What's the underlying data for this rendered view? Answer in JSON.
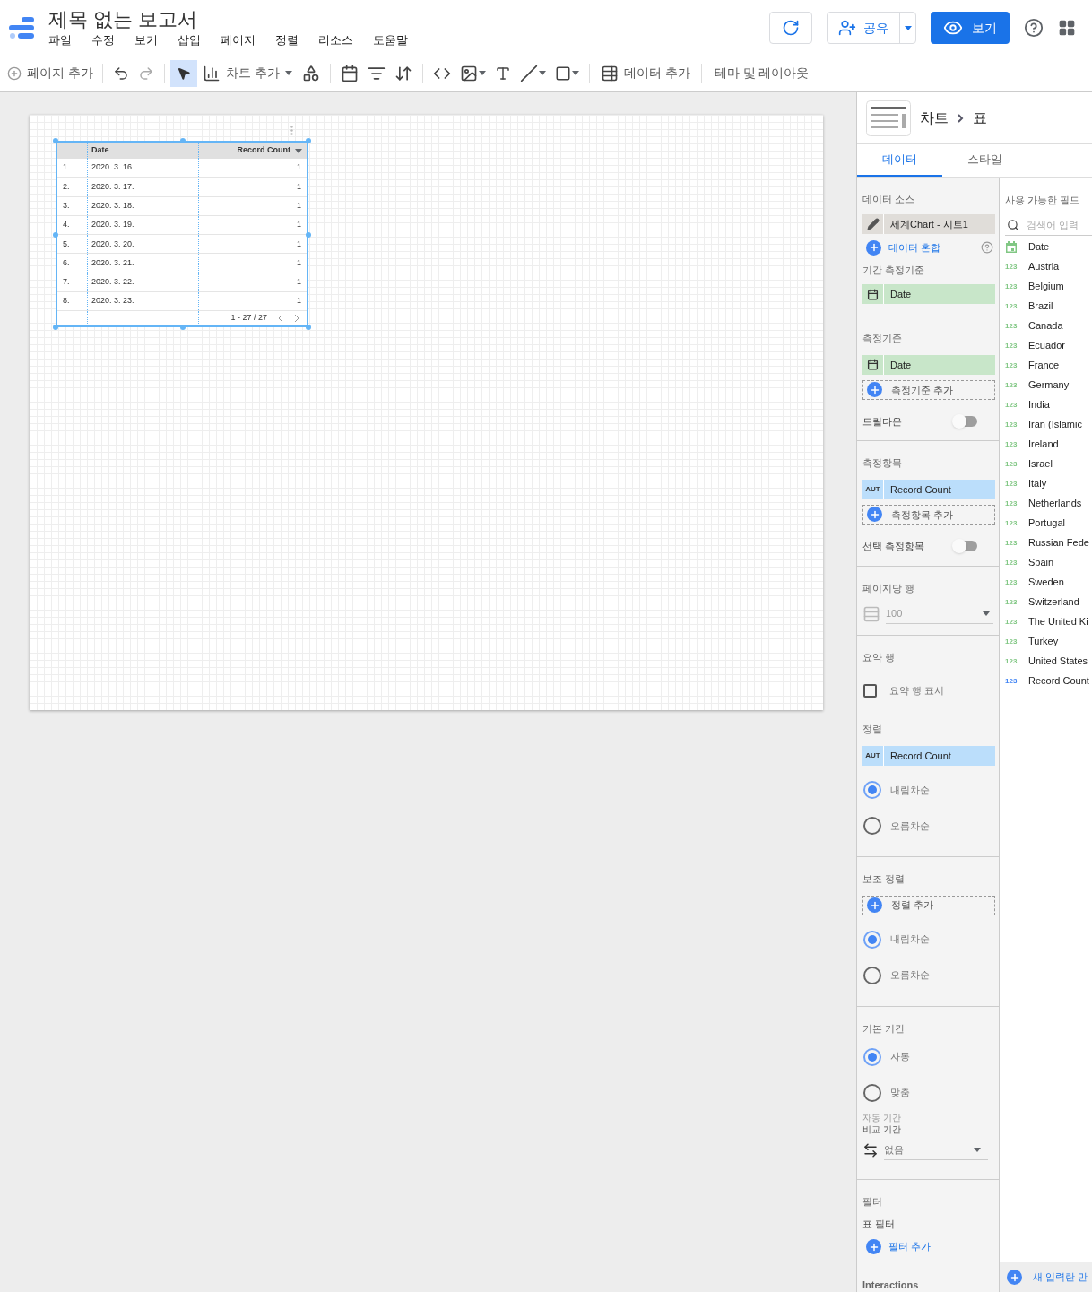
{
  "app": {
    "title": "제목 없는 보고서",
    "menu": [
      "파일",
      "수정",
      "보기",
      "삽입",
      "페이지",
      "정렬",
      "리소스",
      "도움말"
    ],
    "share": "공유",
    "view": "보기"
  },
  "toolbar": {
    "add_page": "페이지 추가",
    "add_chart": "차트 추가",
    "add_data": "데이터 추가",
    "theme": "테마 및 레이아웃",
    "pointer_selected": true
  },
  "table": {
    "columns": [
      "Date",
      "Record Count"
    ],
    "rows": [
      {
        "index": "1.",
        "date": "2020. 3. 16.",
        "count": "1"
      },
      {
        "index": "2.",
        "date": "2020. 3. 17.",
        "count": "1"
      },
      {
        "index": "3.",
        "date": "2020. 3. 18.",
        "count": "1"
      },
      {
        "index": "4.",
        "date": "2020. 3. 19.",
        "count": "1"
      },
      {
        "index": "5.",
        "date": "2020. 3. 20.",
        "count": "1"
      },
      {
        "index": "6.",
        "date": "2020. 3. 21.",
        "count": "1"
      },
      {
        "index": "7.",
        "date": "2020. 3. 22.",
        "count": "1"
      },
      {
        "index": "8.",
        "date": "2020. 3. 23.",
        "count": "1"
      }
    ],
    "pagination": "1 - 27 / 27"
  },
  "panel": {
    "breadcrumb": [
      "차트",
      "표"
    ],
    "tabs": [
      {
        "label": "데이터",
        "selected": true
      },
      {
        "label": "스타일",
        "selected": false
      }
    ],
    "data_source": {
      "heading": "데이터 소스",
      "source": "세계Chart - 시트1",
      "blend": "데이터 혼합"
    },
    "date_range_dimension": {
      "heading": "기간 측정기준",
      "field": "Date"
    },
    "dimension": {
      "heading": "측정기준",
      "field": "Date",
      "add": "측정기준 추가",
      "drilldown": {
        "label": "드릴다운",
        "on": false
      }
    },
    "metric": {
      "heading": "측정항목",
      "aggregation": "AUT",
      "field": "Record Count",
      "add": "측정항목 추가",
      "optional": {
        "label": "선택 측정항목",
        "on": false
      }
    },
    "rows_per_page": {
      "heading": "페이지당 행",
      "value": "100"
    },
    "summary_row": {
      "heading": "요약 행",
      "label": "요약 행 표시",
      "checked": false
    },
    "sort": {
      "heading": "정렬",
      "aggregation": "AUT",
      "field": "Record Count",
      "options": [
        {
          "label": "내림차순",
          "selected": true
        },
        {
          "label": "오름차순",
          "selected": false
        }
      ]
    },
    "secondary_sort": {
      "heading": "보조 정렬",
      "add": "정렬 추가",
      "options": [
        {
          "label": "내림차순",
          "selected": true
        },
        {
          "label": "오름차순",
          "selected": false
        }
      ]
    },
    "default_date_range": {
      "heading": "기본 기간",
      "options": [
        {
          "label": "자동",
          "selected": true
        },
        {
          "label": "맞춤",
          "selected": false
        }
      ],
      "note": "자동 기간",
      "comparison_label": "비교 기간",
      "comparison": "없음"
    },
    "filter": {
      "heading": "필터",
      "sub": "표 필터",
      "add": "필터 추가"
    },
    "interactions": {
      "heading": "Interactions"
    },
    "fields": {
      "heading": "사용 가능한 필드",
      "search_placeholder": "검색어 입력",
      "items": [
        {
          "name": "Date",
          "kind": "date",
          "color": "#81c784"
        },
        {
          "name": "Austria",
          "kind": "number",
          "type_label": "123",
          "color": "#81c784"
        },
        {
          "name": "Belgium",
          "kind": "number",
          "type_label": "123",
          "color": "#81c784"
        },
        {
          "name": "Brazil",
          "kind": "number",
          "type_label": "123",
          "color": "#81c784"
        },
        {
          "name": "Canada",
          "kind": "number",
          "type_label": "123",
          "color": "#81c784"
        },
        {
          "name": "Ecuador",
          "kind": "number",
          "type_label": "123",
          "color": "#81c784"
        },
        {
          "name": "France",
          "kind": "number",
          "type_label": "123",
          "color": "#81c784"
        },
        {
          "name": "Germany",
          "kind": "number",
          "type_label": "123",
          "color": "#81c784"
        },
        {
          "name": "India",
          "kind": "number",
          "type_label": "123",
          "color": "#81c784"
        },
        {
          "name": "Iran (Islamic",
          "kind": "number",
          "type_label": "123",
          "color": "#81c784"
        },
        {
          "name": "Ireland",
          "kind": "number",
          "type_label": "123",
          "color": "#81c784"
        },
        {
          "name": "Israel",
          "kind": "number",
          "type_label": "123",
          "color": "#81c784"
        },
        {
          "name": "Italy",
          "kind": "number",
          "type_label": "123",
          "color": "#81c784"
        },
        {
          "name": "Netherlands",
          "kind": "number",
          "type_label": "123",
          "color": "#81c784"
        },
        {
          "name": "Portugal",
          "kind": "number",
          "type_label": "123",
          "color": "#81c784"
        },
        {
          "name": "Russian Fede",
          "kind": "number",
          "type_label": "123",
          "color": "#81c784"
        },
        {
          "name": "Spain",
          "kind": "number",
          "type_label": "123",
          "color": "#81c784"
        },
        {
          "name": "Sweden",
          "kind": "number",
          "type_label": "123",
          "color": "#81c784"
        },
        {
          "name": "Switzerland",
          "kind": "number",
          "type_label": "123",
          "color": "#81c784"
        },
        {
          "name": "The United Ki",
          "kind": "number",
          "type_label": "123",
          "color": "#81c784"
        },
        {
          "name": "Turkey",
          "kind": "number",
          "type_label": "123",
          "color": "#81c784"
        },
        {
          "name": "United States",
          "kind": "number",
          "type_label": "123",
          "color": "#81c784"
        },
        {
          "name": "Record Count",
          "kind": "number",
          "type_label": "123",
          "color": "#4285f4"
        }
      ],
      "create": "새 입력란 만"
    }
  }
}
